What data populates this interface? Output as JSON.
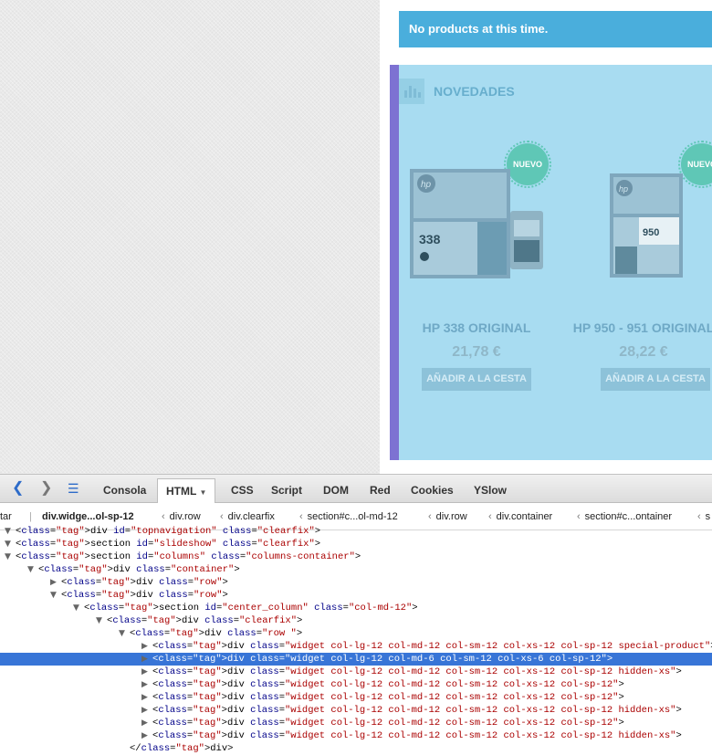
{
  "page": {
    "notice": "No products at this time.",
    "widget_title": "NOVEDADES",
    "products": [
      {
        "badge": "NUEVO",
        "name": "HP 338 ORIGINAL",
        "price": "21,78 €",
        "button": "AÑADIR A LA CESTA",
        "box_label": "338"
      },
      {
        "badge": "NUEVO",
        "name": "HP 950 - 951 ORIGINAL",
        "price": "28,22 €",
        "button": "AÑADIR A LA CESTA",
        "box_label": "950"
      }
    ]
  },
  "firebug": {
    "tabs": [
      "Consola",
      "HTML",
      "CSS",
      "Script",
      "DOM",
      "Red",
      "Cookies",
      "YSlow"
    ],
    "active_tab": "HTML",
    "partial_left_label": "tar",
    "breadcrumbs": [
      "div.widge...ol-sp-12",
      "div.row",
      "div.clearfix",
      "section#c...ol-md-12",
      "div.row",
      "div.container",
      "section#c...ontainer",
      "s"
    ],
    "tree": [
      {
        "text": "<div id=\"topnavigation\" class=\"clearfix\">",
        "indent": 0
      },
      {
        "text": "<section id=\"slideshow\" class=\"clearfix\">",
        "indent": 0
      },
      {
        "text": "<section id=\"columns\" class=\"columns-container\">",
        "indent": 0
      },
      {
        "text": "<div class=\"container\">",
        "indent": 1
      },
      {
        "text": "<div class=\"row\">",
        "indent": 2
      },
      {
        "text": "<div class=\"row\">",
        "indent": 2
      },
      {
        "text": "<section id=\"center_column\" class=\"col-md-12\">",
        "indent": 3
      },
      {
        "text": "<div class=\"clearfix\">",
        "indent": 4
      },
      {
        "text": "<div class=\"row \">",
        "indent": 5
      },
      {
        "text": "<div class=\"widget col-lg-12 col-md-12 col-sm-12 col-xs-12 col-sp-12 special-product\">",
        "indent": 6
      },
      {
        "text": "<div class=\"widget col-lg-12 col-md-6 col-sm-12 col-xs-6 col-sp-12\">",
        "indent": 6
      },
      {
        "text": "<div class=\"widget col-lg-12 col-md-12 col-sm-12 col-xs-12 col-sp-12 hidden-xs\">",
        "indent": 6
      },
      {
        "text": "<div class=\"widget col-lg-12 col-md-12 col-sm-12 col-xs-12 col-sp-12\">",
        "indent": 6
      },
      {
        "text": "<div class=\"widget col-lg-12 col-md-12 col-sm-12 col-xs-12 col-sp-12\">",
        "indent": 6
      },
      {
        "text": "<div class=\"widget col-lg-12 col-md-12 col-sm-12 col-xs-12 col-sp-12 hidden-xs\">",
        "indent": 6
      },
      {
        "text": "<div class=\"widget col-lg-12 col-md-12 col-sm-12 col-xs-12 col-sp-12\">",
        "indent": 6
      },
      {
        "text": "<div class=\"widget col-lg-12 col-md-12 col-sm-12 col-xs-12 col-sp-12 hidden-xs\">",
        "indent": 6
      },
      {
        "text": "</div>",
        "indent": 5
      }
    ],
    "selected_line": 10
  }
}
